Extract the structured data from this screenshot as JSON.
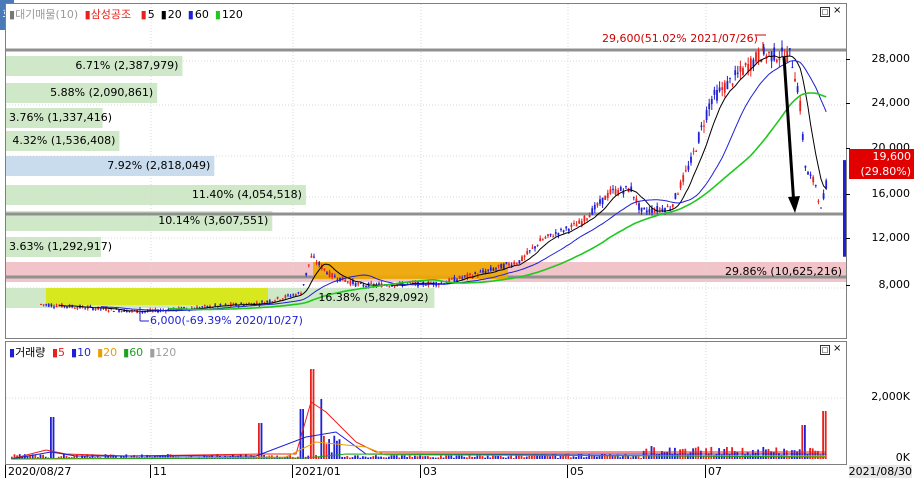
{
  "price_panel": {
    "legend": {
      "prefix": "▮",
      "title": "대기매물(10)",
      "stock": "삼성공조",
      "ma": [
        {
          "label": "5",
          "color": "#e8211b"
        },
        {
          "label": "20",
          "color": "#000000"
        },
        {
          "label": "60",
          "color": "#1f1fd6"
        },
        {
          "label": "120",
          "color": "#1fc81f"
        }
      ]
    },
    "y_ticks": [
      "28,000",
      "24,000",
      "20,000",
      "16,000",
      "12,000",
      "8,000"
    ],
    "price_tag": {
      "price": "19,600",
      "change": "(29.80%)",
      "color": "#e00000"
    },
    "high_annotation": "29,600(51.02% 2021/07/26)",
    "low_annotation": "6,000(-69.39% 2020/10/27)",
    "volume_profile": [
      {
        "label": "6.71% (2,387,979)",
        "frac": 0.21,
        "color": "#cfe8c8"
      },
      {
        "label": "5.88% (2,090,861)",
        "frac": 0.18,
        "color": "#cfe8c8"
      },
      {
        "label": "3.76% (1,337,416)",
        "frac": 0.115,
        "color": "#cfe8c8"
      },
      {
        "label": "4.32% (1,536,408)",
        "frac": 0.135,
        "color": "#cfe8c8"
      },
      {
        "label": "7.92% (2,818,049)",
        "frac": 0.248,
        "color": "#c8dcee"
      },
      {
        "label": "11.40% (4,054,518)",
        "frac": 0.357,
        "color": "#cfe8c8"
      },
      {
        "label": "10.14% (3,607,551)",
        "frac": 0.317,
        "color": "#cfe8c8"
      },
      {
        "label": "3.63% (1,292,917)",
        "frac": 0.113,
        "color": "#cfe8c8"
      },
      {
        "label": "29.86% (10,625,216)",
        "frac": 1.0,
        "color": "#f0c4c8"
      },
      {
        "label": "16.38% (5,829,092)",
        "frac": 0.51,
        "color": "#cfe8c8"
      }
    ]
  },
  "volume_panel": {
    "legend": {
      "prefix": "▮",
      "title": "거래량",
      "ma": [
        {
          "label": "5",
          "color": "#e8211b"
        },
        {
          "label": "10",
          "color": "#1f1fd6"
        },
        {
          "label": "20",
          "color": "#e8a000"
        },
        {
          "label": "60",
          "color": "#1fa01f"
        },
        {
          "label": "120",
          "color": "#a0a0a0"
        }
      ]
    },
    "y_ticks": [
      "2,000K",
      "0K"
    ]
  },
  "x_axis": {
    "start_date": "2020/08/27",
    "end_date": "2021/08/30",
    "ticks": [
      "11",
      "2021/01",
      "03",
      "05",
      "07"
    ]
  },
  "colors": {
    "up": "#e8211b",
    "down": "#1f1fd6",
    "ma5": "#e8211b",
    "ma20": "#000000",
    "ma60": "#1f1fd6",
    "ma120": "#1fc81f",
    "box_yellow": "#d9e800",
    "box_orange": "#f0a800",
    "pink_band": "#f0c4c8"
  }
}
